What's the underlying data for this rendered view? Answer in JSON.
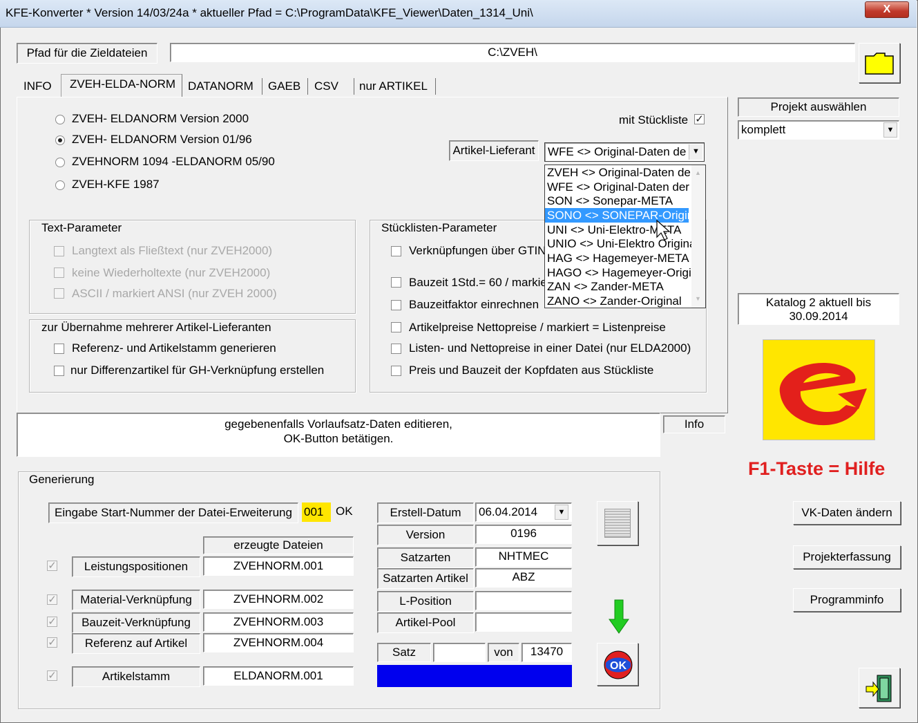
{
  "window": {
    "title": "KFE-Konverter * Version 14/03/24a * aktueller Pfad = C:\\ProgramData\\KFE_Viewer\\Daten_1314_Uni\\",
    "close_label": "X"
  },
  "path": {
    "label": "Pfad für die Zieldateien",
    "value": "C:\\ZVEH\\"
  },
  "tabs": [
    "INFO",
    "ZVEH-ELDA-NORM",
    "DATANORM",
    "GAEB",
    "CSV",
    "nur ARTIKEL"
  ],
  "active_tab": "ZVEH-ELDA-NORM",
  "versions": [
    {
      "label": "ZVEH- ELDANORM Version 2000",
      "selected": false
    },
    {
      "label": "ZVEH- ELDANORM Version 01/96",
      "selected": true
    },
    {
      "label": "ZVEHNORM 1094 -ELDANORM 05/90",
      "selected": false
    },
    {
      "label": "ZVEH-KFE 1987",
      "selected": false
    }
  ],
  "stueckliste": {
    "label": "mit Stückliste",
    "checked": true
  },
  "lieferant": {
    "label": "Artikel-Lieferant",
    "selected": "WFE  <> Original-Daten de",
    "options": [
      "ZVEH <> Original-Daten de",
      "WFE  <> Original-Daten der",
      "SON  <> Sonepar-META",
      "SONO <> SONEPAR-Origir",
      "UNI  <> Uni-Elektro-META",
      "UNIO <> Uni-Elektro Origina",
      "HAG  <> Hagemeyer-META",
      "HAGO <> Hagemeyer-Origir",
      "ZAN  <> Zander-META",
      "ZANO <> Zander-Original"
    ],
    "highlighted": "SONO <> SONEPAR-Origir"
  },
  "text_parameter": {
    "title": "Text-Parameter",
    "items": [
      "Langtext als Fließtext (nur ZVEH2000)",
      "keine Wiederholtexte (nur ZVEH2000)",
      "ASCII / markiert ANSI (nur ZVEH 2000)"
    ]
  },
  "uebernahme": {
    "title": "zur Übernahme mehrerer Artikel-Lieferanten",
    "items": [
      "Referenz- und Artikelstamm generieren",
      "nur Differenzartikel für GH-Verknüpfung erstellen"
    ]
  },
  "stuecklisten_parameter": {
    "title": "Stücklisten-Parameter",
    "items": [
      "Verknüpfungen über GTIN",
      "Bauzeit 1Std.= 60 / markie",
      "Bauzeitfaktor einrechnen",
      "Artikelpreise  Nettopreise / markiert = Listenpreise",
      "Listen- und Nettopreise in einer Datei (nur ELDA2000)",
      "Preis und Bauzeit der Kopfdaten aus Stückliste"
    ]
  },
  "projekt": {
    "label": "Projekt auswählen",
    "value": "komplett"
  },
  "katalog": {
    "line1": "Katalog 2 aktuell bis",
    "line2": "30.09.2014"
  },
  "hint": {
    "line1": "gegebenenfalls Vorlaufsatz-Daten editieren,",
    "line2": "OK-Button betätigen."
  },
  "info_label": "Info",
  "help": "F1-Taste = Hilfe",
  "right_buttons": [
    "VK-Daten ändern",
    "Projekterfassung",
    "Programminfo"
  ],
  "generierung": {
    "title": "Generierung",
    "start_label": "Eingabe Start-Nummer der Datei-Erweiterung",
    "start_value": "001",
    "ok_label": "OK",
    "files_header": "erzeugte Dateien",
    "rows": [
      {
        "label": "Leistungspositionen",
        "file": "ZVEHNORM.001"
      },
      {
        "label": "Material-Verknüpfung",
        "file": "ZVEHNORM.002"
      },
      {
        "label": "Bauzeit-Verknüpfung",
        "file": "ZVEHNORM.003"
      },
      {
        "label": "Referenz auf Artikel",
        "file": "ZVEHNORM.004"
      },
      {
        "label": "Artikelstamm",
        "file": "ELDANORM.001"
      }
    ],
    "fields": [
      {
        "label": "Erstell-Datum",
        "value": "06.04.2014"
      },
      {
        "label": "Version",
        "value": "0196"
      },
      {
        "label": "Satzarten",
        "value": "NHTMEC"
      },
      {
        "label": "Satzarten Artikel",
        "value": "ABZ"
      },
      {
        "label": "L-Position",
        "value": ""
      },
      {
        "label": "Artikel-Pool",
        "value": ""
      }
    ],
    "satz_label": "Satz",
    "satz_value": "",
    "von_label": "von",
    "von_value": "13470",
    "progress": 1.0,
    "ok_icon_label": "OK"
  },
  "colors": {
    "progress": "#0000ee",
    "help_text": "#e02020",
    "logo_bg": "#ffe600",
    "logo_red": "#e3201b",
    "folder": "#ffff00",
    "arrow": "#22cc22"
  }
}
